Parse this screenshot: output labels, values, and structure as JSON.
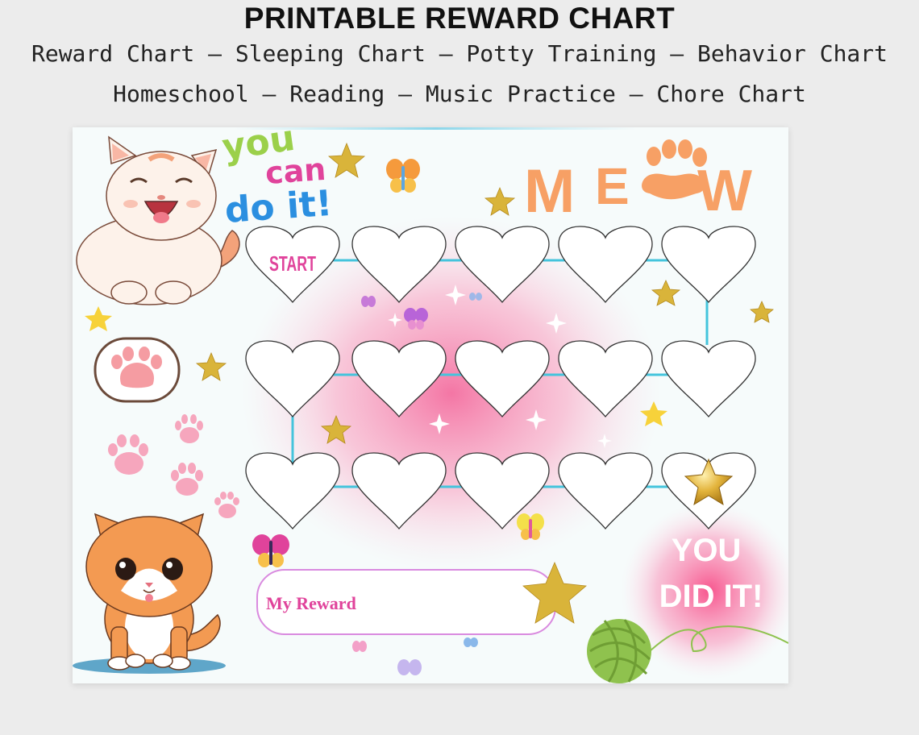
{
  "header": {
    "title": "PRINTABLE REWARD CHART",
    "line1": "Reward Chart – Sleeping Chart – Potty Training – Behavior Chart",
    "line2": "Homeschool – Reading – Music Practice – Chore Chart"
  },
  "chart": {
    "encouragement": [
      "you",
      "can",
      "do it!"
    ],
    "brand": [
      "M",
      "E",
      "W"
    ],
    "start_label": "START",
    "reward_label": "My Reward",
    "finish_label": [
      "YOU",
      "DID IT!"
    ],
    "rows": 3,
    "per_row": 5
  },
  "colors": {
    "accent_pink": "#e0439b",
    "orange": "#f7a065",
    "line_blue": "#44c4dc",
    "gold": "#d9b43a"
  }
}
